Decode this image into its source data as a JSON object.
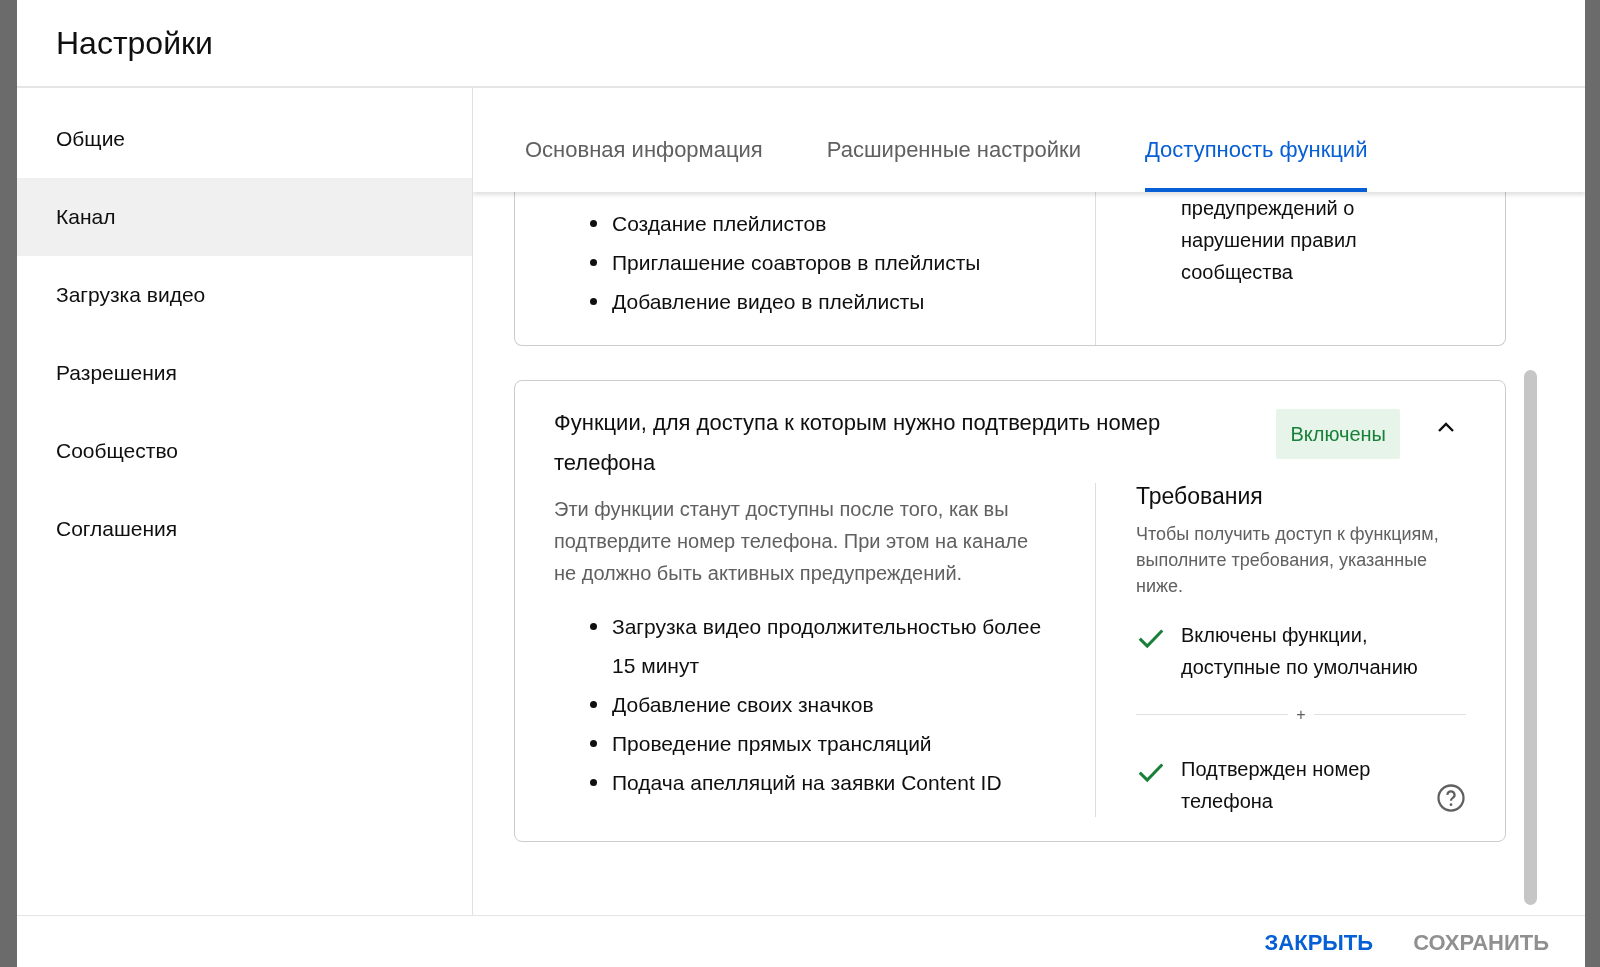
{
  "dialog": {
    "title": "Настройки"
  },
  "sidebar": {
    "items": [
      {
        "label": "Общие",
        "selected": false
      },
      {
        "label": "Канал",
        "selected": true
      },
      {
        "label": "Загрузка видео",
        "selected": false
      },
      {
        "label": "Разрешения",
        "selected": false
      },
      {
        "label": "Сообщество",
        "selected": false
      },
      {
        "label": "Соглашения",
        "selected": false
      }
    ]
  },
  "tabs": [
    {
      "label": "Основная информация",
      "selected": false
    },
    {
      "label": "Расширенные настройки",
      "selected": false
    },
    {
      "label": "Доступность функций",
      "selected": true
    }
  ],
  "cards": [
    {
      "items": [
        "Создание плейлистов",
        "Приглашение соавторов в плейлисты",
        "Добавление видео в плейлисты"
      ],
      "side_text": "предупреждений о нарушении правил сообщества"
    },
    {
      "title": "Функции, для доступа к которым нужно подтвердить номер телефона",
      "status": "Включены",
      "expanded": true,
      "description": "Эти функции станут доступны после того, как вы подтвердите номер телефона. При этом на канале не должно быть активных предупреждений.",
      "items": [
        "Загрузка видео продолжительностью более 15 минут",
        "Добавление своих значков",
        "Проведение прямых трансляций",
        "Подача апелляций на заявки Content ID"
      ],
      "requirements": {
        "title": "Требования",
        "description": "Чтобы получить доступ к функциям, выполните требования, указанные ниже.",
        "joiner": "+",
        "items": [
          {
            "label": "Включены функции, доступные по умолчанию",
            "met": true,
            "help": false
          },
          {
            "label": "Подтвержден номер телефона",
            "met": true,
            "help": true
          }
        ]
      }
    }
  ],
  "footer": {
    "buttons": [
      {
        "label": "ЗАКРЫТЬ",
        "disabled": false
      },
      {
        "label": "СОХРАНИТЬ",
        "disabled": true
      }
    ]
  }
}
